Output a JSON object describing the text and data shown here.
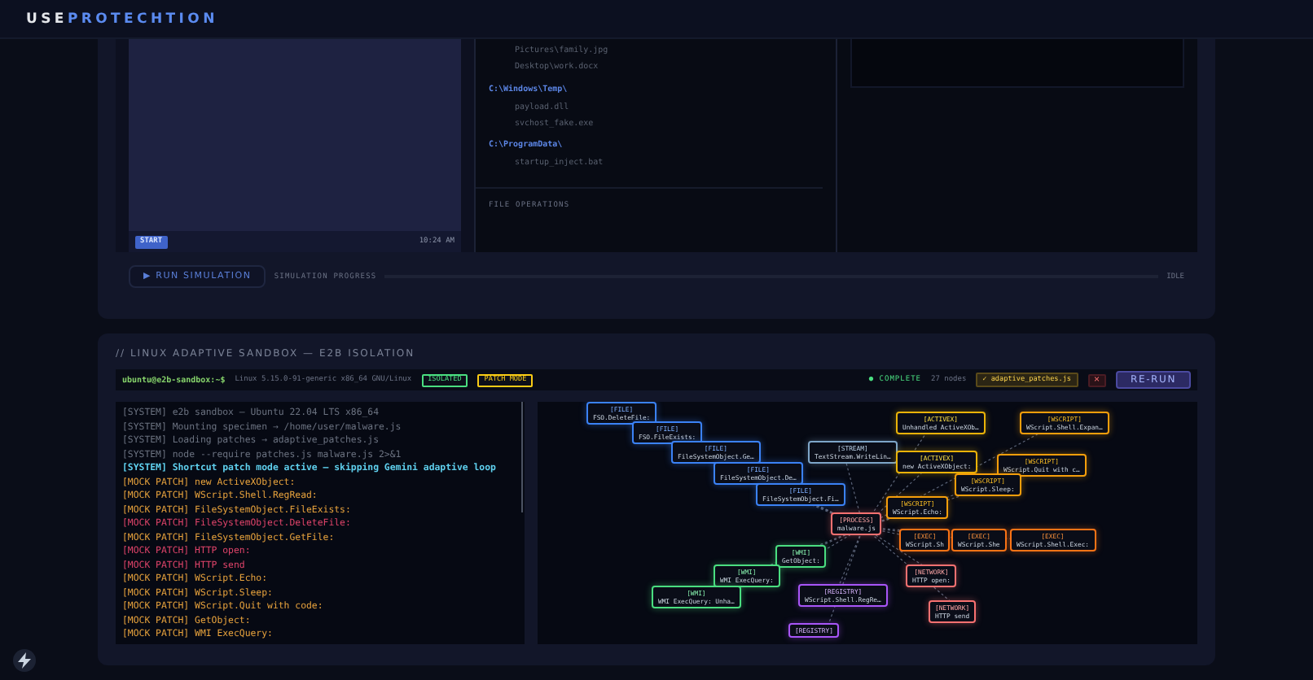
{
  "header": {
    "logo_prefix": "USE",
    "logo_suffix": "PROTECHTION"
  },
  "simulator": {
    "taskbar": {
      "start": "START",
      "time": "10:24 AM"
    },
    "file_tree": [
      {
        "kind": "file",
        "text": "Pictures\\family.jpg"
      },
      {
        "kind": "file",
        "text": "Desktop\\work.docx"
      },
      {
        "kind": "folder",
        "text": "C:\\Windows\\Temp\\"
      },
      {
        "kind": "file",
        "text": "payload.dll"
      },
      {
        "kind": "file",
        "text": "svchost_fake.exe"
      },
      {
        "kind": "folder",
        "text": "C:\\ProgramData\\"
      },
      {
        "kind": "file",
        "text": "startup_inject.bat"
      }
    ],
    "section_label": "FILE OPERATIONS",
    "run_button": "▶ RUN SIMULATION",
    "progress_label": "SIMULATION PROGRESS",
    "status": "IDLE"
  },
  "sandbox": {
    "title": "// LINUX ADAPTIVE SANDBOX — E2B ISOLATION",
    "prompt": "ubuntu@e2b-sandbox:~$",
    "kernel": "Linux 5.15.0-91-generic x86_64 GNU/Linux",
    "badges": [
      {
        "text": "ISOLATED",
        "color": "#4ade80"
      },
      {
        "text": "PATCH MODE",
        "color": "#facc15"
      }
    ],
    "state": "● COMPLETE",
    "node_count": "27 nodes",
    "patch_file": "✓ adaptive_patches.js",
    "close": "×",
    "rerun": "RE-RUN",
    "log": [
      {
        "kind": "system",
        "text": "[SYSTEM] e2b sandbox — Ubuntu 22.04 LTS x86_64"
      },
      {
        "kind": "system",
        "text": "[SYSTEM] Mounting specimen → /home/user/malware.js"
      },
      {
        "kind": "system",
        "text": "[SYSTEM] Loading patches → adaptive_patches.js"
      },
      {
        "kind": "system",
        "text": "[SYSTEM] node --require patches.js malware.js 2>&1"
      },
      {
        "kind": "info",
        "text": "[SYSTEM] Shortcut patch mode active — skipping Gemini adaptive loop"
      },
      {
        "kind": "patch",
        "text": "[MOCK PATCH] new ActiveXObject:"
      },
      {
        "kind": "patch",
        "text": "[MOCK PATCH] WScript.Shell.RegRead:"
      },
      {
        "kind": "patch",
        "text": "[MOCK PATCH] FileSystemObject.FileExists:"
      },
      {
        "kind": "alert",
        "text": "[MOCK PATCH] FileSystemObject.DeleteFile:"
      },
      {
        "kind": "patch",
        "text": "[MOCK PATCH] FileSystemObject.GetFile:"
      },
      {
        "kind": "alert",
        "text": "[MOCK PATCH] HTTP open:"
      },
      {
        "kind": "alert",
        "text": "[MOCK PATCH] HTTP send"
      },
      {
        "kind": "patch",
        "text": "[MOCK PATCH] WScript.Echo:"
      },
      {
        "kind": "patch",
        "text": "[MOCK PATCH] WScript.Sleep:"
      },
      {
        "kind": "patch",
        "text": "[MOCK PATCH] WScript.Quit with code:"
      },
      {
        "kind": "patch",
        "text": "[MOCK PATCH] GetObject:"
      },
      {
        "kind": "patch",
        "text": "[MOCK PATCH] WMI ExecQuery:"
      }
    ],
    "nodes": [
      {
        "kind": "file",
        "label": "[FILE]",
        "text": "FSO.DeleteFile:"
      },
      {
        "kind": "file",
        "label": "[FILE]",
        "text": "FSO.FileExists:"
      },
      {
        "kind": "file",
        "label": "[FILE]",
        "text": "FileSystemObject.Ge…"
      },
      {
        "kind": "file",
        "label": "[FILE]",
        "text": "FileSystemObject.De…"
      },
      {
        "kind": "file",
        "label": "[FILE]",
        "text": "FileSystemObject.Fi…"
      },
      {
        "kind": "stream",
        "label": "[STREAM]",
        "text": "TextStream.WriteLin…"
      },
      {
        "kind": "activex",
        "label": "[ACTIVEX]",
        "text": "Unhandled ActiveXOb…"
      },
      {
        "kind": "activex",
        "label": "[ACTIVEX]",
        "text": "new ActiveXObject:"
      },
      {
        "kind": "wscript",
        "label": "[WSCRIPT]",
        "text": "WScript.Shell.Expan…"
      },
      {
        "kind": "wscript",
        "label": "[WSCRIPT]",
        "text": "WScript.Quit with c…"
      },
      {
        "kind": "wscript",
        "label": "[WSCRIPT]",
        "text": "WScript.Sleep:"
      },
      {
        "kind": "wscript",
        "label": "[WSCRIPT]",
        "text": "WScript.Echo:"
      },
      {
        "kind": "process",
        "label": "[PROCESS]",
        "text": "malware.js"
      },
      {
        "kind": "exec",
        "label": "[EXEC]",
        "text": "WScript.Sh"
      },
      {
        "kind": "exec",
        "label": "[EXEC]",
        "text": "WScript.She"
      },
      {
        "kind": "exec",
        "label": "[EXEC]",
        "text": "WScript.Shell.Exec:"
      },
      {
        "kind": "wmi",
        "label": "[WMI]",
        "text": "GetObject:"
      },
      {
        "kind": "wmi",
        "label": "[WMI]",
        "text": "WMI ExecQuery:"
      },
      {
        "kind": "wmi",
        "label": "[WMI]",
        "text": "WMI ExecQuery: Unha…"
      },
      {
        "kind": "registry",
        "label": "[REGISTRY]",
        "text": "WScript.Shell.RegRe…"
      },
      {
        "kind": "network",
        "label": "[NETWORK]",
        "text": "HTTP open:"
      },
      {
        "kind": "network",
        "label": "[NETWORK]",
        "text": "HTTP send"
      },
      {
        "kind": "registry",
        "label": "[REGISTRY]"
      }
    ]
  }
}
